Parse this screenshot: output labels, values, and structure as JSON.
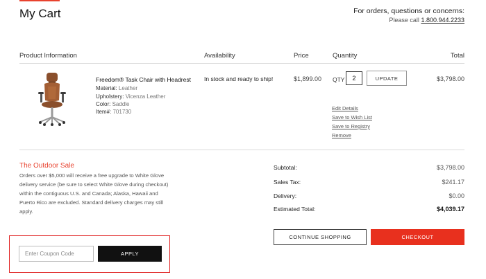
{
  "header": {
    "title": "My Cart",
    "contact_heading": "For orders, questions or concerns:",
    "contact_prefix": "Please call",
    "phone": "1.800.944.2233"
  },
  "table": {
    "columns": [
      "Product Information",
      "Availability",
      "Price",
      "Quantity",
      "Total"
    ]
  },
  "item": {
    "name": "Freedom® Task Chair with Headrest",
    "attributes": [
      {
        "label": "Material:",
        "value": "Leather"
      },
      {
        "label": "Upholstery:",
        "value": "Vicenza Leather"
      },
      {
        "label": "Color:",
        "value": "Saddle"
      },
      {
        "label": "Item#:",
        "value": "701730"
      }
    ],
    "availability": "In stock and ready to ship!",
    "price": "$1,899.00",
    "qty_label": "QTY",
    "quantity": "2",
    "update_label": "UPDATE",
    "total": "$3,798.00",
    "links": [
      "Edit Details",
      "Save to Wish List",
      "Save to Registry",
      "Remove"
    ]
  },
  "promo": {
    "title": "The Outdoor Sale",
    "text": "Orders over $5,000 will receive a free upgrade to White Glove delivery service (be sure to select White Glove during checkout) within the contiguous U.S. and Canada; Alaska, Hawaii and Puerto Rico are excluded. Standard delivery charges may still apply."
  },
  "summary": {
    "subtotal_label": "Subtotal:",
    "subtotal": "$3,798.00",
    "tax_label": "Sales Tax:",
    "tax": "$241.17",
    "delivery_label": "Delivery:",
    "delivery": "$0.00",
    "estimated_label": "Estimated Total:",
    "estimated": "$4,039.17"
  },
  "actions": {
    "continue_label": "CONTINUE SHOPPING",
    "checkout_label": "CHECKOUT"
  },
  "coupon": {
    "placeholder": "Enter Coupon Code",
    "apply_label": "APPLY"
  },
  "colors": {
    "accent": "#e8422e",
    "checkout": "#e8301e",
    "apply": "#111111",
    "highlight_border": "#e02020"
  },
  "icons": {
    "product_image": "office-chair-image"
  }
}
